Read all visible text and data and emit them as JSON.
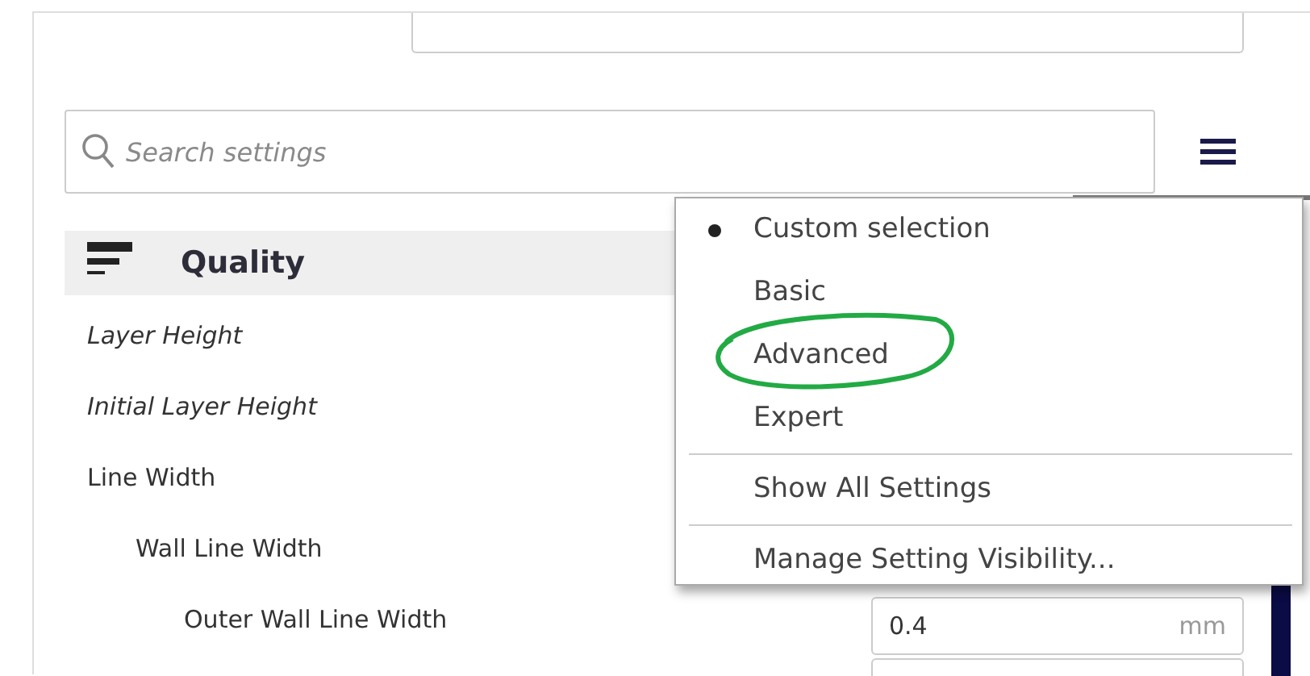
{
  "search": {
    "placeholder": "Search settings"
  },
  "category": {
    "title": "Quality"
  },
  "settings": [
    {
      "label": "Layer Height",
      "italic": true
    },
    {
      "label": "Initial Layer Height",
      "italic": true
    },
    {
      "label": "Line Width",
      "italic": false,
      "children": [
        {
          "label": "Wall Line Width",
          "italic": false,
          "children": [
            {
              "label": "Outer Wall Line Width",
              "italic": false,
              "value": "0.4",
              "unit": "mm"
            }
          ]
        }
      ]
    }
  ],
  "visibility_menu": {
    "presets": [
      {
        "label": "Custom selection",
        "selected": true
      },
      {
        "label": "Basic",
        "selected": false
      },
      {
        "label": "Advanced",
        "selected": false
      },
      {
        "label": "Expert",
        "selected": false
      }
    ],
    "actions": [
      "Show All Settings",
      "Manage Setting Visibility..."
    ]
  }
}
